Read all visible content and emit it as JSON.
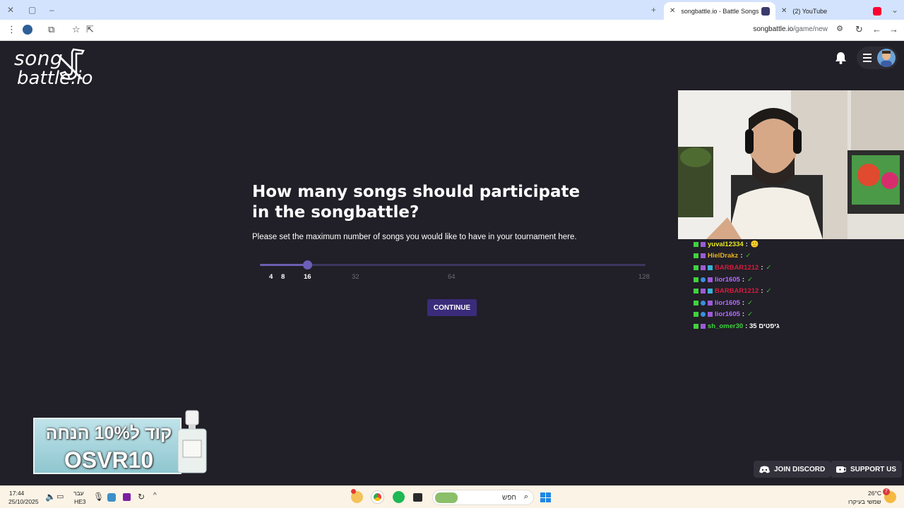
{
  "browser": {
    "tabs": [
      {
        "title": "songbattle.io - Battle Songs ag",
        "active": true
      },
      {
        "title": "(2) YouTube",
        "active": false
      }
    ],
    "url_host": "songbattle.io",
    "url_path": "/game/new"
  },
  "site": {
    "logo_line1": "song",
    "logo_line2": "battle.io"
  },
  "game": {
    "question": "How many songs should participate in the songbattle?",
    "subtext": "Please set the maximum number of songs you would like to have in your tournament here.",
    "slider": {
      "options": [
        "4",
        "8",
        "16",
        "32",
        "64",
        "128"
      ],
      "selected": "16"
    },
    "continue_label": "CONTINUE"
  },
  "chat": [
    {
      "user": "yuval12334",
      "color": "#e8e81e",
      "msg": ":",
      "emote": "🙂"
    },
    {
      "user": "HielDrakz",
      "color": "#e6b422",
      "msg": ":",
      "emote": "✓"
    },
    {
      "user": "BARBAR1212",
      "color": "#d01f3c",
      "msg": ":",
      "emote": "✓"
    },
    {
      "user": "lior1605",
      "color": "#b36bff",
      "msg": ":",
      "emote": "✓"
    },
    {
      "user": "BARBAR1212",
      "color": "#d01f3c",
      "msg": ":",
      "emote": "✓"
    },
    {
      "user": "lior1605",
      "color": "#b36bff",
      "msg": ":",
      "emote": "✓"
    },
    {
      "user": "lior1605",
      "color": "#b36bff",
      "msg": ":",
      "emote": "✓"
    },
    {
      "user": "sh_omer30",
      "color": "#3fd23f",
      "msg": ": 35 גיפטים",
      "emote": ""
    }
  ],
  "promo": {
    "line1": "קוד ל10% הנחה",
    "line2": "OSVR10"
  },
  "footer": {
    "discord_label": "JOIN DISCORD",
    "support_label": "SUPPORT US"
  },
  "taskbar": {
    "time": "17:44",
    "date": "25/10/2025",
    "lang1": "עבר",
    "lang2": "HE3",
    "search_placeholder": "חפש",
    "weather_temp": "26°C",
    "weather_desc": "שמשי בעיקרו",
    "notif_count": "7"
  },
  "colors": {
    "accent": "#6c5fb8",
    "button": "#3a2c7a",
    "page_bg": "#211f27"
  }
}
